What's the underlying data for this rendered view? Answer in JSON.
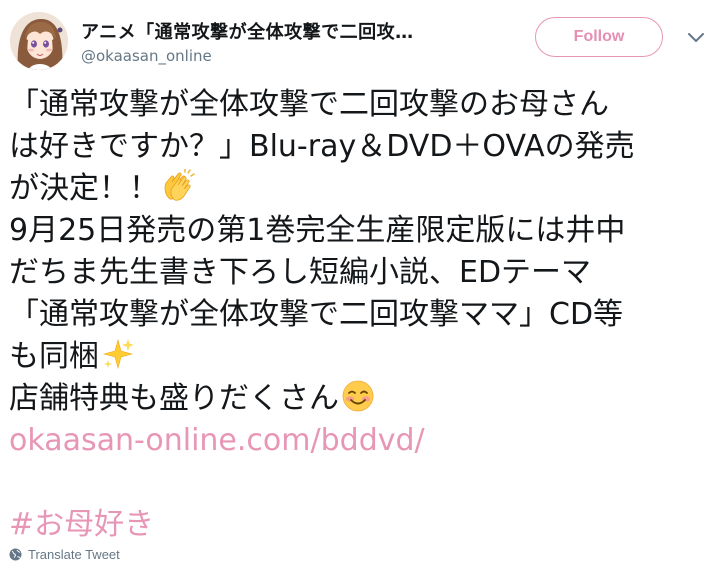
{
  "header": {
    "display_name": "アニメ「通常攻撃が全体攻撃で二回攻…",
    "username": "@okaasan_online",
    "follow_label": "Follow",
    "avatar_icon": "user-avatar",
    "menu_icon": "chevron-down-icon"
  },
  "tweet": {
    "line1": "「通常攻撃が全体攻撃で二回攻撃のお母さん",
    "line2": "は好きですか？」Blu-ray＆DVD＋OVAの発売",
    "line3": "が決定！！",
    "line4": "9月25日発売の第1巻完全生産限定版には井中",
    "line5": "だちま先生書き下ろし短編小説、EDテーマ",
    "line6": "「通常攻撃が全体攻撃で二回攻撃ママ」CD等",
    "line7": "も同梱",
    "line8": "店舗特典も盛りだくさん",
    "link": "okaasan-online.com/bddvd/",
    "hashtag": "#お母好き",
    "emoji_1": "clapping-hands-emoji",
    "emoji_2": "sparkles-emoji",
    "emoji_3": "smiling-face-emoji"
  },
  "footer": {
    "translate_label": "Translate Tweet",
    "translate_icon": "globe-icon"
  },
  "colors": {
    "accent_pink": "#e896b6",
    "text": "#14171a",
    "secondary_text": "#657786"
  }
}
